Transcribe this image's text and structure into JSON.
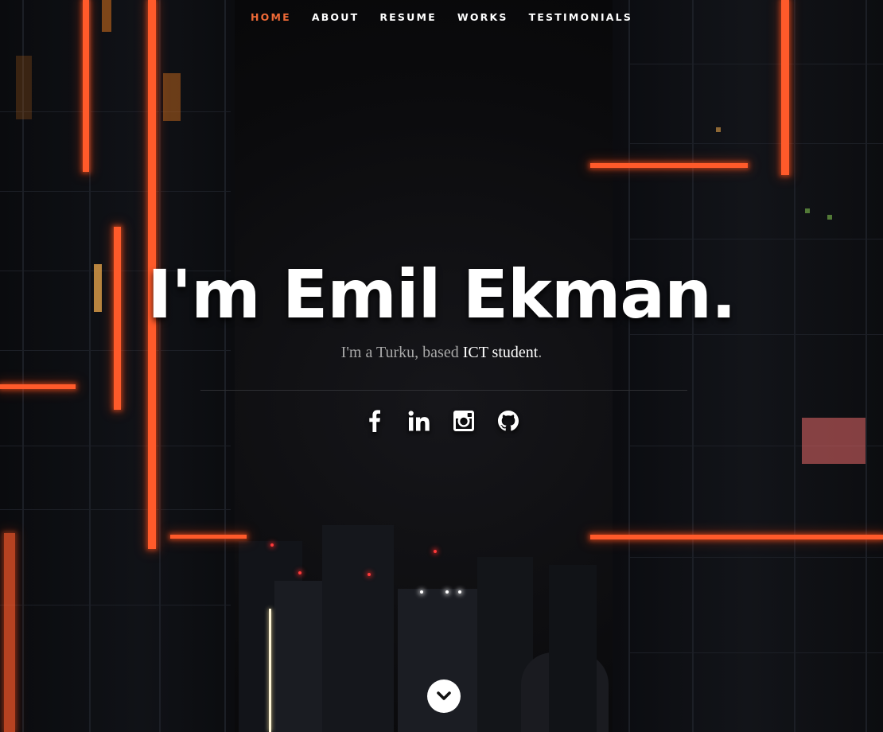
{
  "nav": {
    "items": [
      {
        "label": "HOME",
        "active": true
      },
      {
        "label": "ABOUT",
        "active": false
      },
      {
        "label": "RESUME",
        "active": false
      },
      {
        "label": "WORKS",
        "active": false
      },
      {
        "label": "TESTIMONIALS",
        "active": false
      }
    ],
    "active_color": "#ef6a37"
  },
  "hero": {
    "title": "I'm Emil Ekman.",
    "tagline_prefix": "I'm a Turku, based ",
    "tagline_highlight": "ICT student",
    "tagline_suffix": "."
  },
  "social": [
    {
      "icon": "facebook-icon"
    },
    {
      "icon": "linkedin-icon"
    },
    {
      "icon": "instagram-icon"
    },
    {
      "icon": "github-icon"
    }
  ],
  "scroll": {
    "icon": "chevron-down-icon"
  },
  "colors": {
    "accent": "#ef6a37",
    "neon": "#ff5a2a",
    "background": "#070708"
  }
}
